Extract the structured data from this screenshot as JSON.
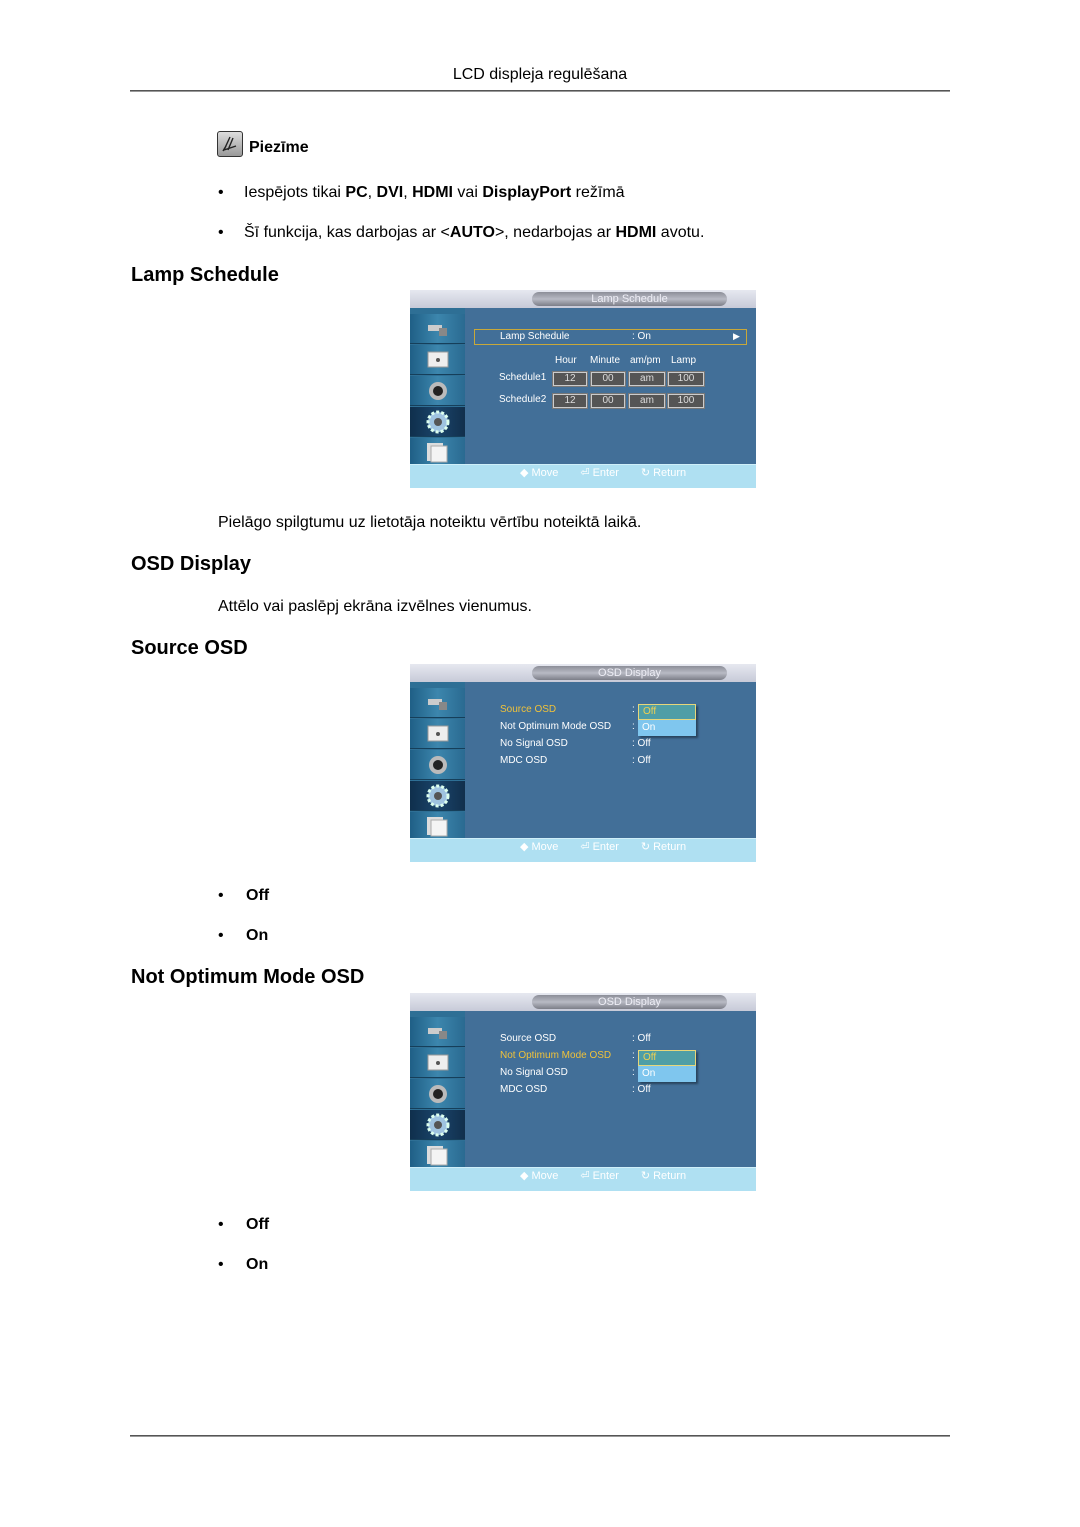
{
  "header": {
    "title": "LCD displeja regulēšana"
  },
  "note": {
    "icon": "note-pencil-icon",
    "label": "Piezīme",
    "bullets": [
      {
        "parts": [
          {
            "t": "Iespējots tikai ",
            "b": false
          },
          {
            "t": "PC",
            "b": true
          },
          {
            "t": ", ",
            "b": false
          },
          {
            "t": "DVI",
            "b": true
          },
          {
            "t": ", ",
            "b": false
          },
          {
            "t": "HDMI",
            "b": true
          },
          {
            "t": " vai ",
            "b": false
          },
          {
            "t": "DisplayPort",
            "b": true
          },
          {
            "t": " režīmā",
            "b": false
          }
        ]
      },
      {
        "parts": [
          {
            "t": "Šī funkcija, kas darbojas ar <",
            "b": false
          },
          {
            "t": "AUTO",
            "b": true
          },
          {
            "t": ">, nedarbojas ar ",
            "b": false
          },
          {
            "t": "HDMI",
            "b": true
          },
          {
            "t": " avotu.",
            "b": false
          }
        ]
      }
    ]
  },
  "sections": {
    "lamp_schedule": {
      "title": "Lamp Schedule",
      "description": "Pielāgo spilgtumu uz lietotāja noteiktu vērtību noteiktā laikā.",
      "osd": {
        "title": "Lamp Schedule",
        "row_label": "Lamp Schedule",
        "row_value": ": On",
        "row_arrow": "▶",
        "columns": [
          "Hour",
          "Minute",
          "am/pm",
          "Lamp"
        ],
        "schedules": [
          {
            "label": "Schedule1",
            "values": [
              "12",
              "00",
              "am",
              "100"
            ]
          },
          {
            "label": "Schedule2",
            "values": [
              "12",
              "00",
              "am",
              "100"
            ]
          }
        ]
      }
    },
    "osd_display": {
      "title": "OSD Display",
      "description": "Attēlo vai paslēpj ekrāna izvēlnes vienumus."
    },
    "source_osd": {
      "title": "Source OSD",
      "osd": {
        "title": "OSD Display",
        "items": [
          {
            "label": "Source OSD",
            "value": ": Off"
          },
          {
            "label": "Not Optimum Mode OSD",
            "value": ": On"
          },
          {
            "label": "No Signal OSD",
            "value": ": Off"
          },
          {
            "label": "MDC OSD",
            "value": ": Off"
          }
        ],
        "dropdown": [
          "Off",
          "On"
        ]
      },
      "options": [
        "Off",
        "On"
      ]
    },
    "not_optimum": {
      "title": "Not Optimum Mode OSD",
      "osd": {
        "title": "OSD Display",
        "items": [
          {
            "label": "Source OSD",
            "value": ": Off"
          },
          {
            "label": "Not Optimum Mode OSD",
            "value": ": Off"
          },
          {
            "label": "No Signal OSD",
            "value": ": On"
          },
          {
            "label": "MDC OSD",
            "value": ": Off"
          }
        ],
        "dropdown": [
          "Off",
          "On"
        ]
      },
      "options": [
        "Off",
        "On"
      ]
    }
  },
  "osd_common": {
    "sidebar_icons": [
      "picture-icon",
      "display-icon",
      "sound-icon",
      "setup-gear-icon",
      "multi-screen-icon"
    ],
    "footer": {
      "move": "Move",
      "enter": "Enter",
      "return": "Return"
    },
    "colors": {
      "main_bg": "#426f98",
      "selected_text": "#f0c23a",
      "footer_bg": "#afe0f2",
      "dropdown_bg": "#7fc6ee"
    }
  },
  "bullet_glyph": "•"
}
